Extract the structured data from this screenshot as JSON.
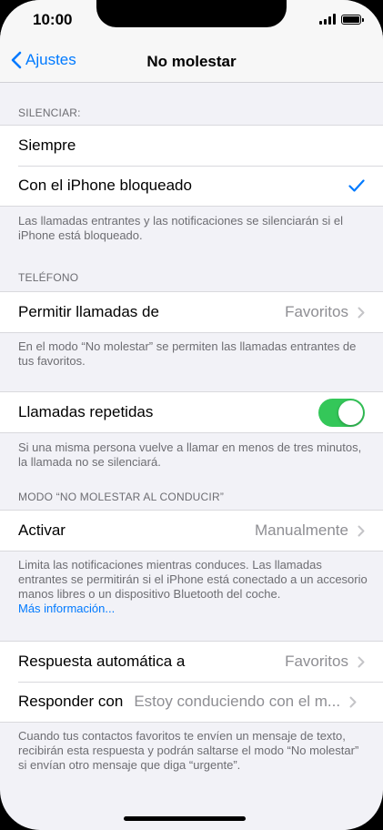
{
  "status": {
    "time": "10:00"
  },
  "nav": {
    "back_label": "Ajustes",
    "title": "No molestar"
  },
  "silenciar": {
    "header": "SILENCIAR:",
    "options": [
      {
        "label": "Siempre",
        "selected": false
      },
      {
        "label": "Con el iPhone bloqueado",
        "selected": true
      }
    ],
    "footer": "Las llamadas entrantes y las notificaciones se silenciarán si el iPhone está bloqueado."
  },
  "telefono": {
    "header": "TELÉFONO",
    "permitir_label": "Permitir llamadas de",
    "permitir_value": "Favoritos",
    "permitir_footer": "En el modo “No molestar” se permiten las llamadas entrantes de tus favoritos.",
    "repetidas_label": "Llamadas repetidas",
    "repetidas_on": true,
    "repetidas_footer": "Si una misma persona vuelve a llamar en menos de tres minutos, la llamada no se silenciará."
  },
  "conducir": {
    "header": "MODO “NO MOLESTAR AL CONDUCIR”",
    "activar_label": "Activar",
    "activar_value": "Manualmente",
    "activar_footer": "Limita las notificaciones mientras conduces. Las llamadas entrantes se permitirán si el iPhone está conectado a un accesorio manos libres o un dispositivo Bluetooth del coche.",
    "link": "Más información...",
    "respuesta_label": "Respuesta automática a",
    "respuesta_value": "Favoritos",
    "responder_label": "Responder con",
    "responder_value": "Estoy conduciendo con el m...",
    "footer": "Cuando tus contactos favoritos te envíen un mensaje de texto, recibirán esta respuesta y podrán saltarse el modo “No molestar” si envían otro mensaje que diga “urgente”."
  },
  "colors": {
    "accent": "#007aff",
    "toggle_on": "#34c759",
    "background": "#f2f2f7",
    "secondary_text": "#6d6d72",
    "value_text": "#8e8e93"
  }
}
